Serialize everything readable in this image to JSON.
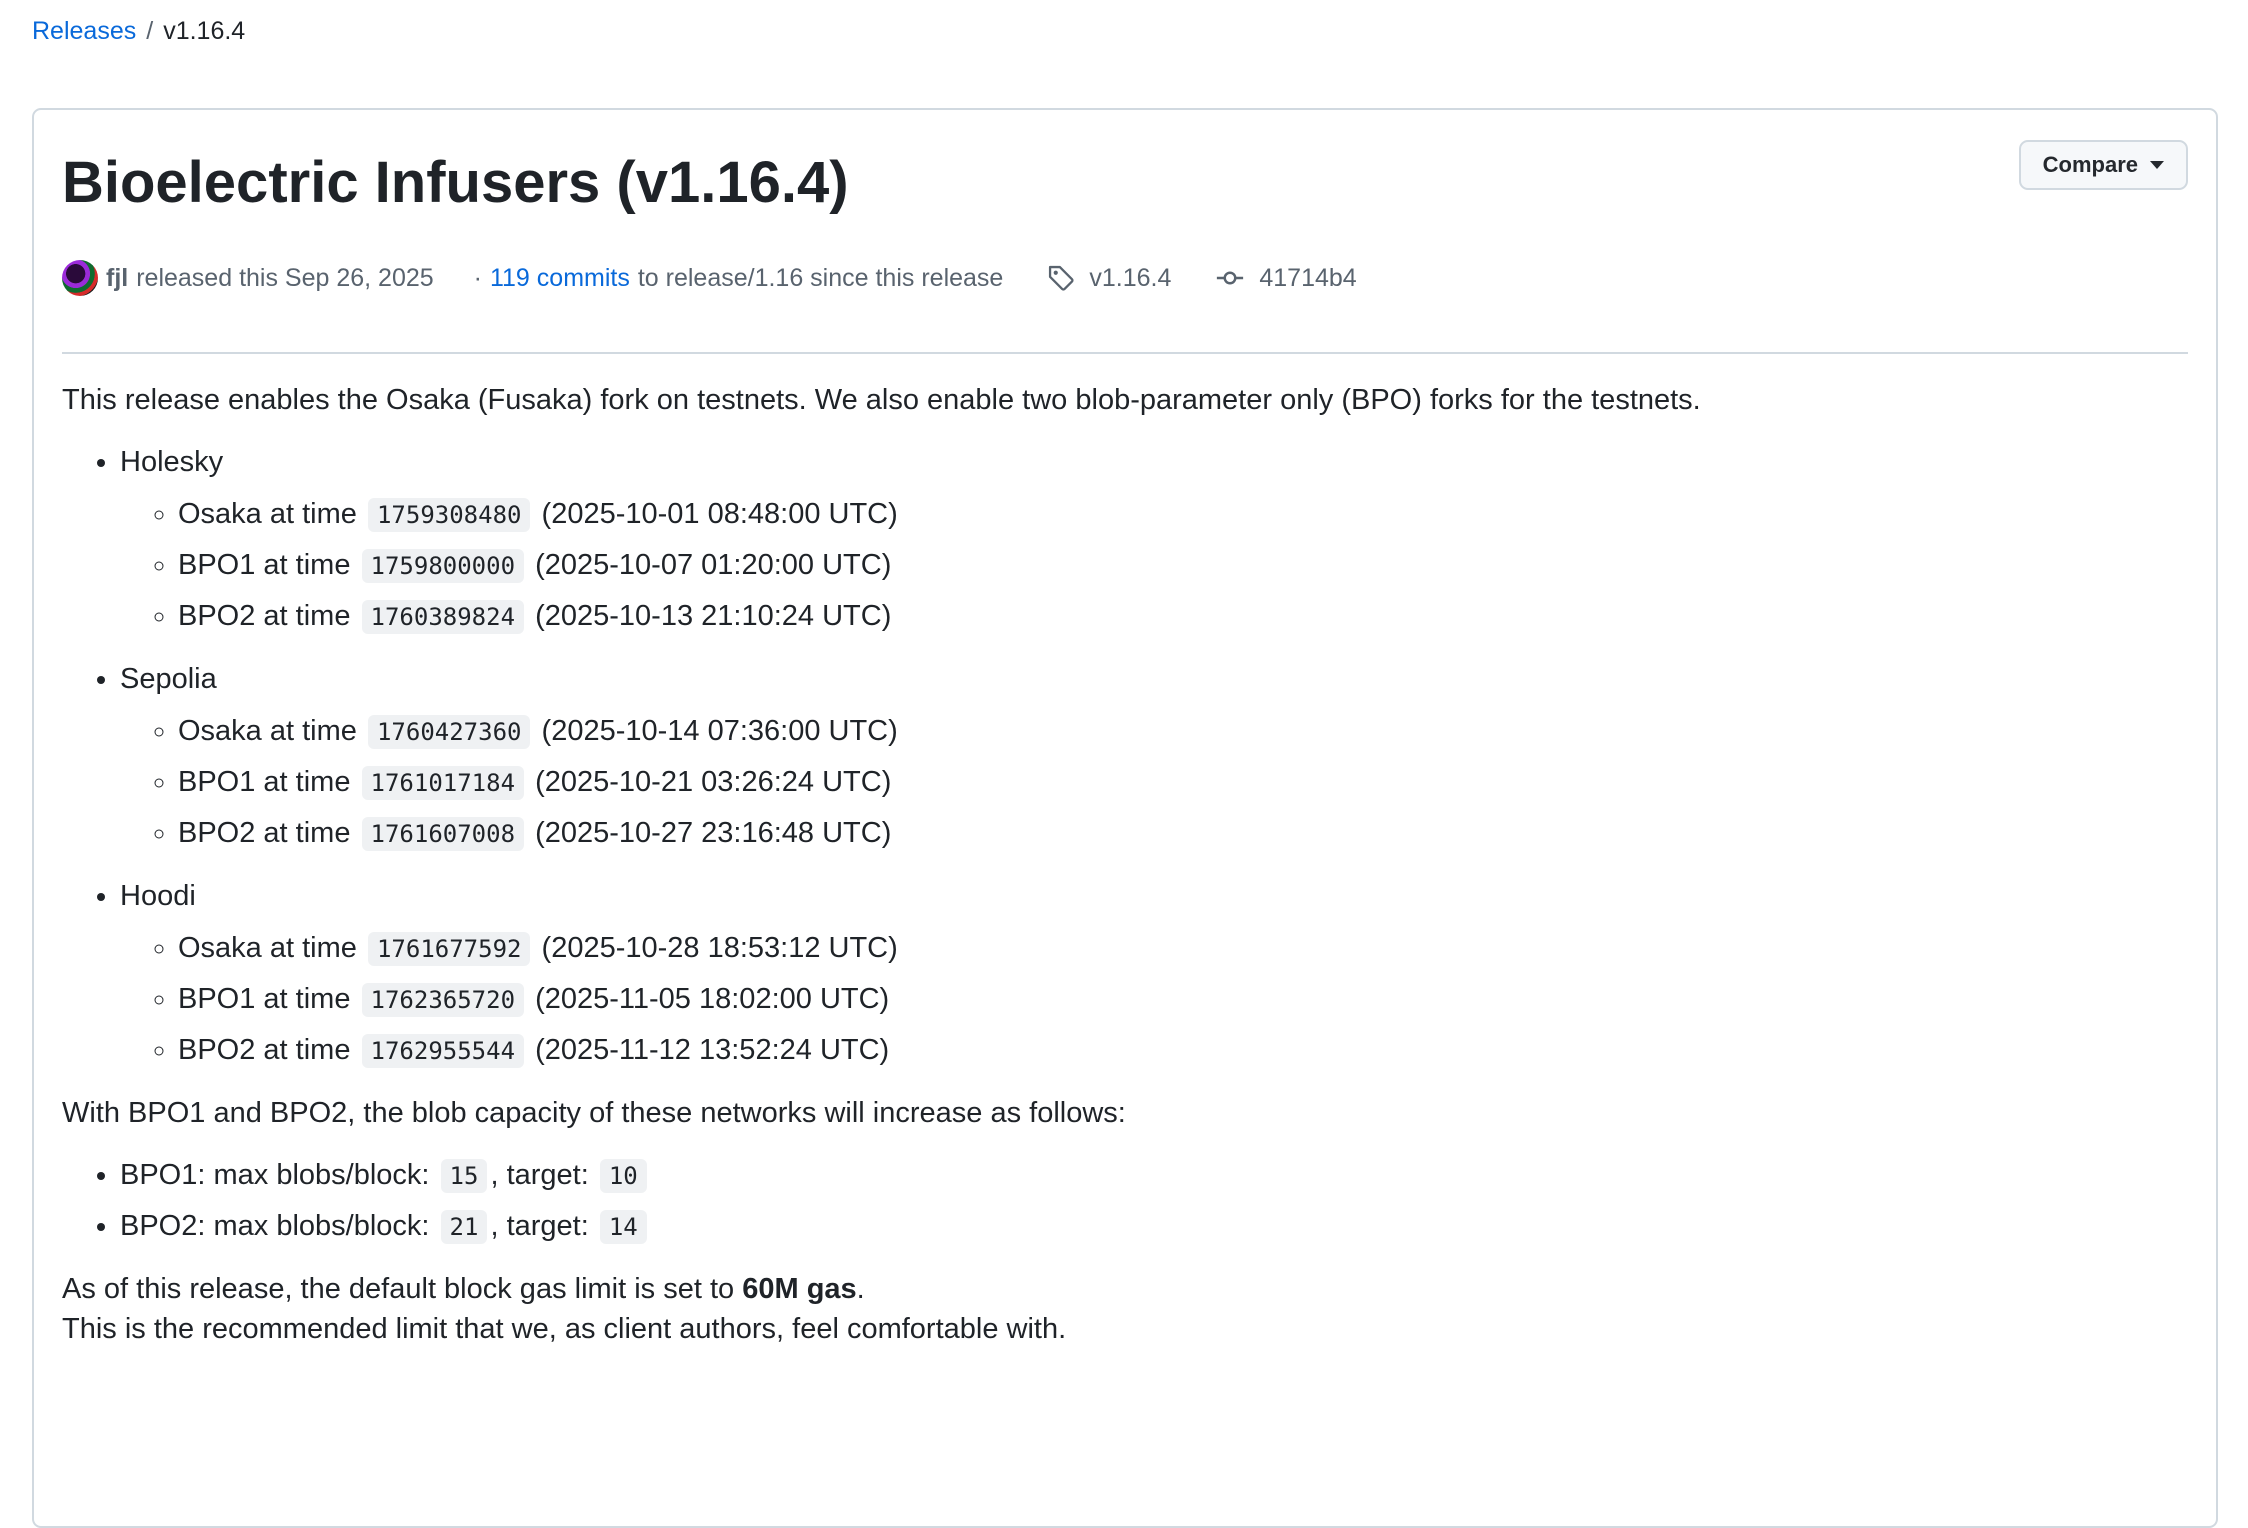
{
  "breadcrumb": {
    "releases": "Releases",
    "separator": "/",
    "current": "v1.16.4"
  },
  "release": {
    "title": "Bioelectric Infusers (v1.16.4)",
    "compare_label": "Compare",
    "author": "fjl",
    "released_text": "released this Sep 26, 2025",
    "dot": "·",
    "commits_link": "119 commits",
    "since_text": "to release/1.16 since this release",
    "tag": "v1.16.4",
    "commit": "41714b4"
  },
  "notes": {
    "intro": "This release enables the Osaka (Fusaka) fork on testnets. We also enable two blob-parameter only (BPO) forks for the testnets.",
    "networks": [
      {
        "name": "Holesky",
        "forks": [
          {
            "label": "Osaka at time",
            "timestamp": "1759308480",
            "date": "(2025-10-01 08:48:00 UTC)"
          },
          {
            "label": "BPO1 at time",
            "timestamp": "1759800000",
            "date": "(2025-10-07 01:20:00 UTC)"
          },
          {
            "label": "BPO2 at time",
            "timestamp": "1760389824",
            "date": "(2025-10-13 21:10:24 UTC)"
          }
        ]
      },
      {
        "name": "Sepolia",
        "forks": [
          {
            "label": "Osaka at time",
            "timestamp": "1760427360",
            "date": "(2025-10-14 07:36:00 UTC)"
          },
          {
            "label": "BPO1 at time",
            "timestamp": "1761017184",
            "date": "(2025-10-21 03:26:24 UTC)"
          },
          {
            "label": "BPO2 at time",
            "timestamp": "1761607008",
            "date": "(2025-10-27 23:16:48 UTC)"
          }
        ]
      },
      {
        "name": "Hoodi",
        "forks": [
          {
            "label": "Osaka at time",
            "timestamp": "1761677592",
            "date": "(2025-10-28 18:53:12 UTC)"
          },
          {
            "label": "BPO1 at time",
            "timestamp": "1762365720",
            "date": "(2025-11-05 18:02:00 UTC)"
          },
          {
            "label": "BPO2 at time",
            "timestamp": "1762955544",
            "date": "(2025-11-12 13:52:24 UTC)"
          }
        ]
      }
    ],
    "capacity_intro": "With BPO1 and BPO2, the blob capacity of these networks will increase as follows:",
    "capacity": [
      {
        "label": "BPO1: max blobs/block:",
        "max": "15",
        "target_label": ", target:",
        "target": "10"
      },
      {
        "label": "BPO2: max blobs/block:",
        "max": "21",
        "target_label": ", target:",
        "target": "14"
      }
    ],
    "gas_prefix": "As of this release, the default block gas limit is set to",
    "gas_value": "60M gas",
    "gas_suffix": ".",
    "gas_note": "This is the recommended limit that we, as client authors, feel comfortable with."
  }
}
